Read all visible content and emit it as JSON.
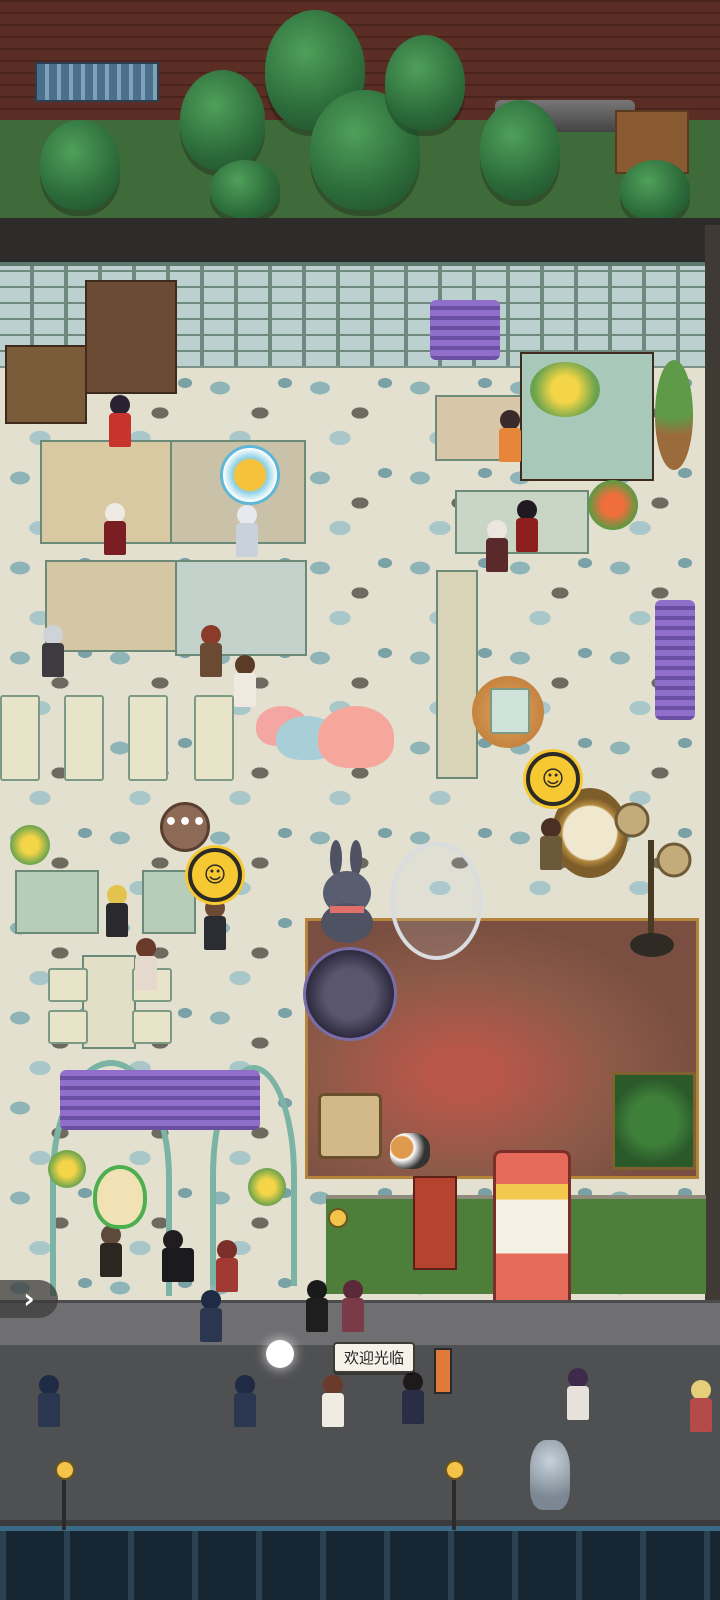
{
  "scene": {
    "signs": {
      "welcome_label": "欢迎光临"
    },
    "overlays": {
      "chat_bubble_glyph": "•••",
      "emote_icon": "smiley-face-icon",
      "expand_arrow_glyph": "›",
      "coin_icon": "gold-coin-icon",
      "owl_icon": "owl-guide-icon"
    },
    "colors": {
      "emote_yellow": "#f6c832",
      "marker_cyan": "#5fb6d6",
      "owl_ring_green": "#4caf50",
      "rug_red": "#b9574a",
      "floor_stone": "#e3e0cf"
    }
  }
}
